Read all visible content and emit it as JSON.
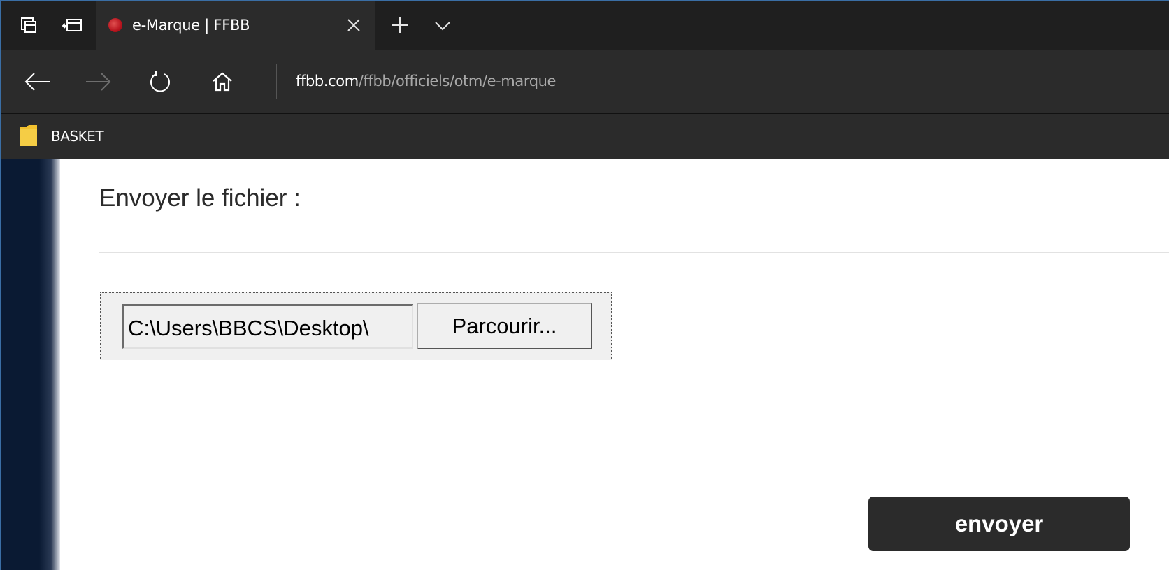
{
  "browser": {
    "tab": {
      "title": "e-Marque | FFBB",
      "favicon": "ffbb-logo-icon"
    },
    "address": {
      "host": "ffbb.com",
      "path": "/ffbb/officiels/otm/e-marque"
    },
    "favorites": [
      {
        "label": "BASKET",
        "icon": "folder-icon"
      }
    ]
  },
  "page": {
    "heading": "Envoyer le fichier :",
    "file_input": {
      "value": "C:\\Users\\BBCS\\Desktop\\",
      "browse_label": "Parcourir..."
    },
    "submit_label": "envoyer"
  },
  "colors": {
    "chrome": "#2b2b2b",
    "tabbar": "#1f1f1f",
    "button": "#2b2b2b",
    "sidebar": "#0a1a33"
  }
}
